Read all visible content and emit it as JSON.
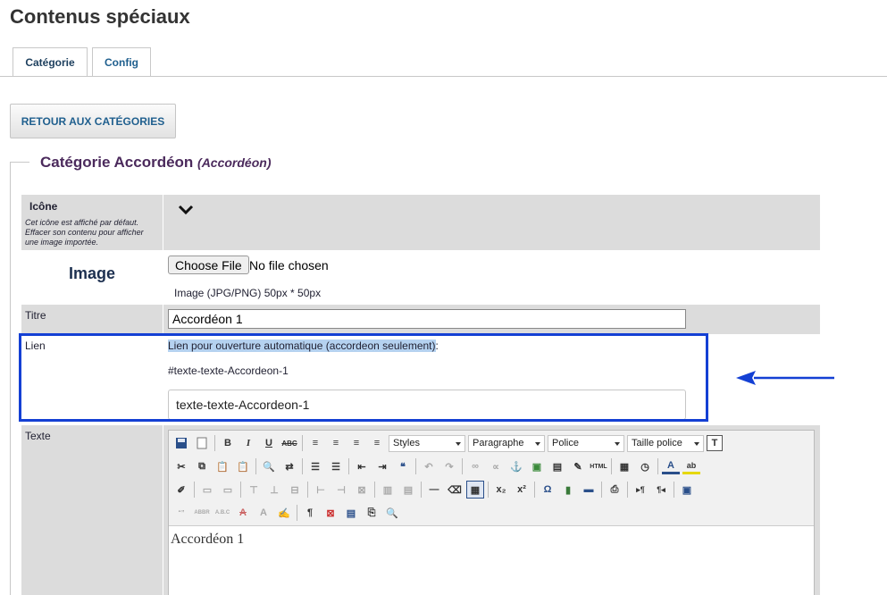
{
  "page": {
    "title": "Contenus spéciaux"
  },
  "tabs": [
    {
      "label": "Catégorie"
    },
    {
      "label": "Config"
    }
  ],
  "back_button": {
    "label": "RETOUR AUX CATÉGORIES"
  },
  "category": {
    "title": "Catégorie Accordéon",
    "subtitle": "(Accordéon)"
  },
  "form": {
    "icone": {
      "label": "Icône",
      "help": "Cet icône est affiché par défaut. Effacer son contenu pour afficher une image importée."
    },
    "image": {
      "label": "Image",
      "choose_button": "Choose File",
      "no_file": "No file chosen",
      "hint": "Image (JPG/PNG) 50px * 50px"
    },
    "titre": {
      "label": "Titre",
      "value": "Accordéon 1"
    },
    "lien": {
      "label": "Lien",
      "heading_highlighted": "Lien pour ouverture automatique (accordeon seulement)",
      "heading_suffix": ":",
      "anchor": "#texte-texte-Accordeon-1",
      "value": "texte-texte-Accordeon-1"
    },
    "texte": {
      "label": "Texte"
    }
  },
  "editor": {
    "selects": {
      "styles": "Styles",
      "paragraph": "Paragraphe",
      "font": "Police",
      "size": "Taille police"
    },
    "content": "Accordéon 1"
  },
  "colors": {
    "accent": "#1f5f8e",
    "highlight_box": "#1440d4",
    "legend": "#4b2a5c"
  }
}
